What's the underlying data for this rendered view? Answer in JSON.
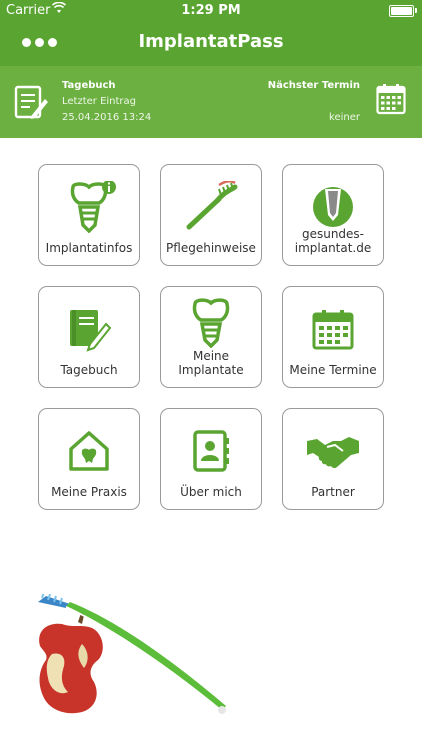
{
  "status_bar": {
    "carrier": "Carrier",
    "time": "1:29 PM"
  },
  "header": {
    "title": "ImplantatPass"
  },
  "info": {
    "diary_title": "Tagebuch",
    "last_entry_label": "Letzter Eintrag",
    "last_entry_date": "25.04.2016 13:24",
    "next_appointment_title": "Nächster Termin",
    "next_appointment_value": "keiner"
  },
  "tiles": [
    {
      "label": "Implantatinfos",
      "icon": "implant-info-icon"
    },
    {
      "label": "Pflegehinweise",
      "icon": "toothbrush-icon"
    },
    {
      "label": "gesundes-\nimplantat.de",
      "icon": "website-logo-icon"
    },
    {
      "label": "Tagebuch",
      "icon": "diary-icon"
    },
    {
      "label": "Meine\nImplantate",
      "icon": "implant-icon"
    },
    {
      "label": "Meine Termine",
      "icon": "calendar-icon"
    },
    {
      "label": "Meine Praxis",
      "icon": "practice-house-icon"
    },
    {
      "label": "Über mich",
      "icon": "contact-book-icon"
    },
    {
      "label": "Partner",
      "icon": "handshake-icon"
    }
  ],
  "colors": {
    "primary": "#5aa532",
    "info_bar": "#6cb041",
    "icon_green": "#5aa532"
  }
}
